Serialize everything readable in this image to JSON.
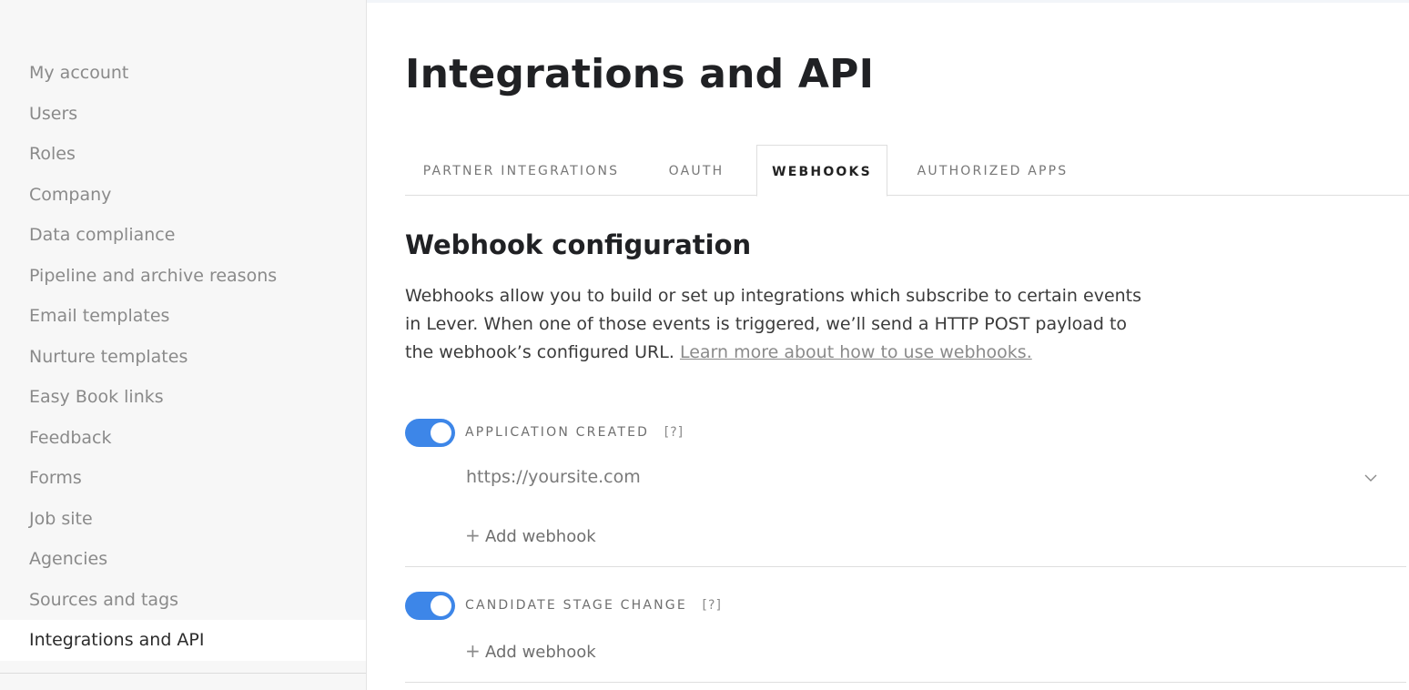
{
  "sidebar": {
    "items": [
      {
        "label": "My account"
      },
      {
        "label": "Users"
      },
      {
        "label": "Roles"
      },
      {
        "label": "Company"
      },
      {
        "label": "Data compliance"
      },
      {
        "label": "Pipeline and archive reasons"
      },
      {
        "label": "Email templates"
      },
      {
        "label": "Nurture templates"
      },
      {
        "label": "Easy Book links"
      },
      {
        "label": "Feedback"
      },
      {
        "label": "Forms"
      },
      {
        "label": "Job site"
      },
      {
        "label": "Agencies"
      },
      {
        "label": "Sources and tags"
      },
      {
        "label": "Integrations and API"
      }
    ],
    "active_index": 14
  },
  "main": {
    "title": "Integrations and API",
    "tabs": [
      {
        "label": "PARTNER INTEGRATIONS"
      },
      {
        "label": "OAUTH"
      },
      {
        "label": "WEBHOOKS"
      },
      {
        "label": "AUTHORIZED APPS"
      }
    ],
    "active_tab": "WEBHOOKS",
    "section_title": "Webhook configuration",
    "description": "Webhooks allow you to build or set up integrations which subscribe to certain events in Lever. When one of those events is triggered, we’ll send a HTTP POST payload to the webhook’s configured URL.",
    "learn_more_link": "Learn more about how to use webhooks.",
    "webhooks": [
      {
        "event": "APPLICATION CREATED",
        "help": "[?]",
        "enabled": true,
        "url_placeholder": "https://yoursite.com",
        "add_label": "Add webhook"
      },
      {
        "event": "CANDIDATE STAGE CHANGE",
        "help": "[?]",
        "enabled": true,
        "add_label": "Add webhook"
      }
    ]
  },
  "colors": {
    "toggle_on": "#3d86e8",
    "sidebar_bg": "#f7f7f7"
  },
  "icons": {
    "toggle": "toggle-switch-icon",
    "chevron": "chevron-down-icon",
    "plus": "plus-icon"
  }
}
